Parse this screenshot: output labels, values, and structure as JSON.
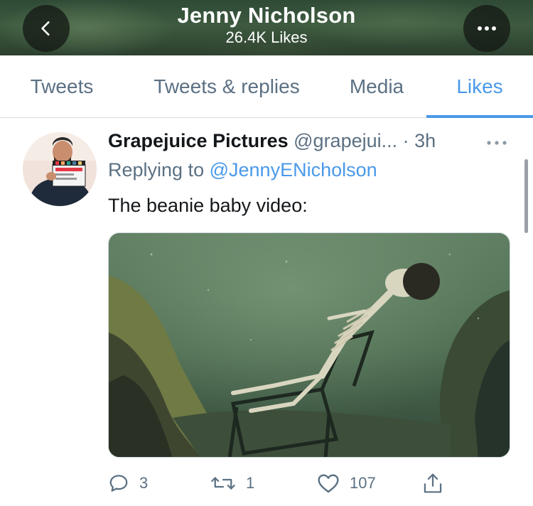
{
  "header": {
    "title": "Jenny Nicholson",
    "subtitle": "26.4K Likes"
  },
  "tabs": [
    {
      "label": "Tweets",
      "active": false
    },
    {
      "label": "Tweets & replies",
      "active": false
    },
    {
      "label": "Media",
      "active": false
    },
    {
      "label": "Likes",
      "active": true
    }
  ],
  "tweet": {
    "author_name": "Grapejuice Pictures",
    "handle": "@grapejui...",
    "separator": "·",
    "time": "3h",
    "replying_prefix": "Replying to",
    "replying_to": "@JennyENicholson",
    "text": "The beanie baby video:",
    "actions": {
      "replies": "3",
      "retweets": "1",
      "likes": "107"
    }
  },
  "colors": {
    "accent": "#4a99e9",
    "secondary_text": "#5b7083",
    "primary_text": "#14171a"
  },
  "icons": [
    "back-icon",
    "more-icon",
    "reply-icon",
    "retweet-icon",
    "like-icon",
    "share-icon"
  ]
}
